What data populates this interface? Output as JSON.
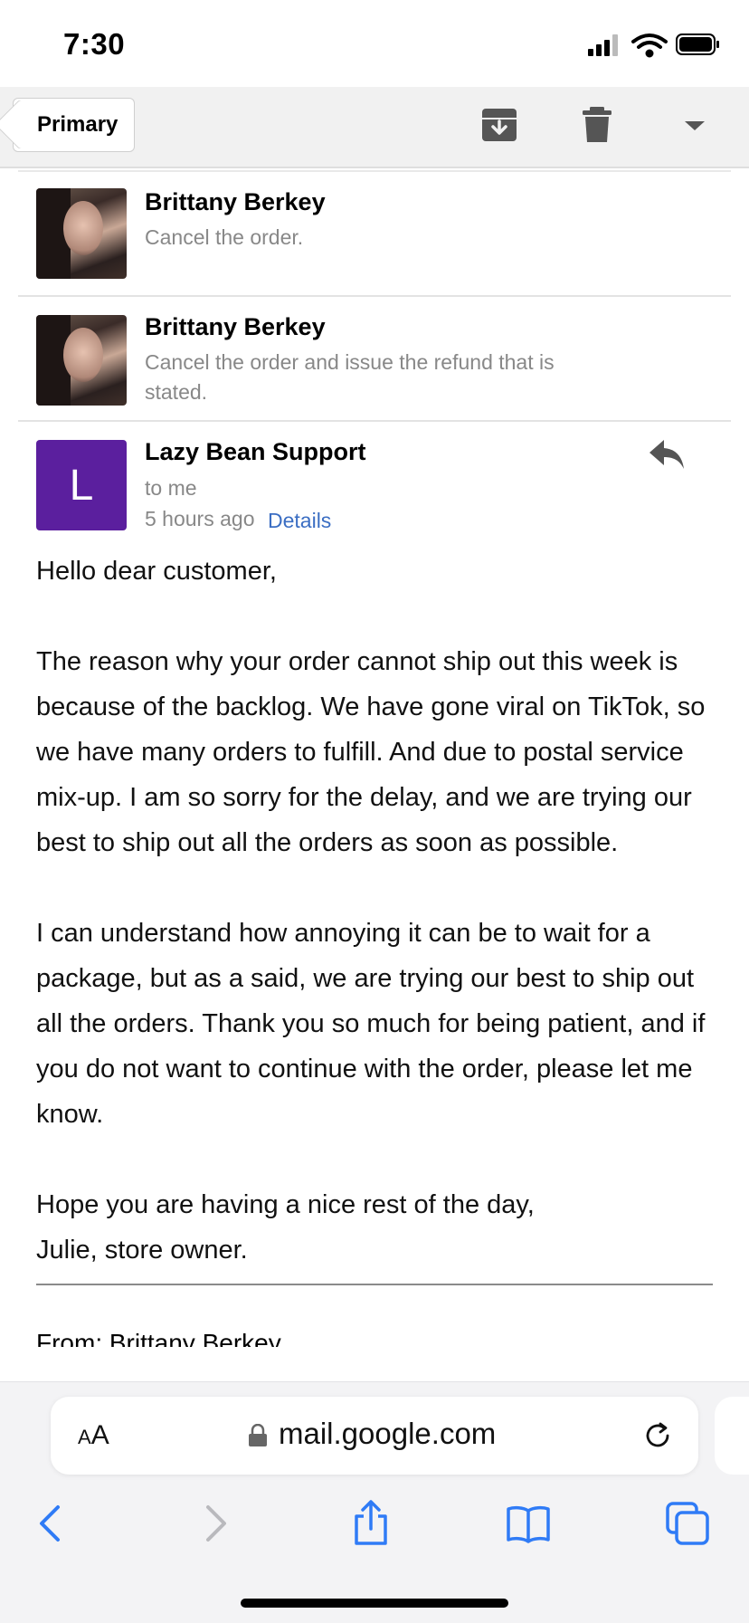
{
  "status_bar": {
    "time": "7:30"
  },
  "header": {
    "back_label": "Primary",
    "icons": [
      "archive-icon",
      "trash-icon",
      "dropdown-arrow-icon"
    ]
  },
  "thread": [
    {
      "sender": "Brittany Berkey",
      "snippet": "Cancel the order."
    },
    {
      "sender": "Brittany Berkey",
      "snippet": "Cancel the order and issue the refund that is stated."
    }
  ],
  "message": {
    "avatar_letter": "L",
    "avatar_color": "#5b1f9e",
    "sender": "Lazy Bean Support",
    "to": "to me",
    "time": "5 hours ago",
    "details_label": "Details",
    "body": {
      "greeting": "Hello dear customer,",
      "p1": "The reason why your order cannot ship out this week is because of the backlog. We have gone viral on TikTok, so we have many orders to fulfill. And due to postal service mix-up. I am so sorry for the delay, and we are trying our best to ship out all the orders as soon as possible.",
      "p2": "I can understand how annoying it can be to wait for a package, but as a said, we are trying our best to ship out all the orders. Thank you so much for being patient, and if you do not want to continue with the order, please let me know.",
      "closing": "Hope you are having a nice rest of the day,",
      "signature": "Julie, store owner."
    },
    "quoted_partial": "From: Brittany Berkey"
  },
  "browser": {
    "text_size_label_big": "A",
    "text_size_label_small": "A",
    "url": "mail.google.com"
  },
  "colors": {
    "link": "#3b6ec3",
    "safari_icon": "#2f7bf6"
  }
}
